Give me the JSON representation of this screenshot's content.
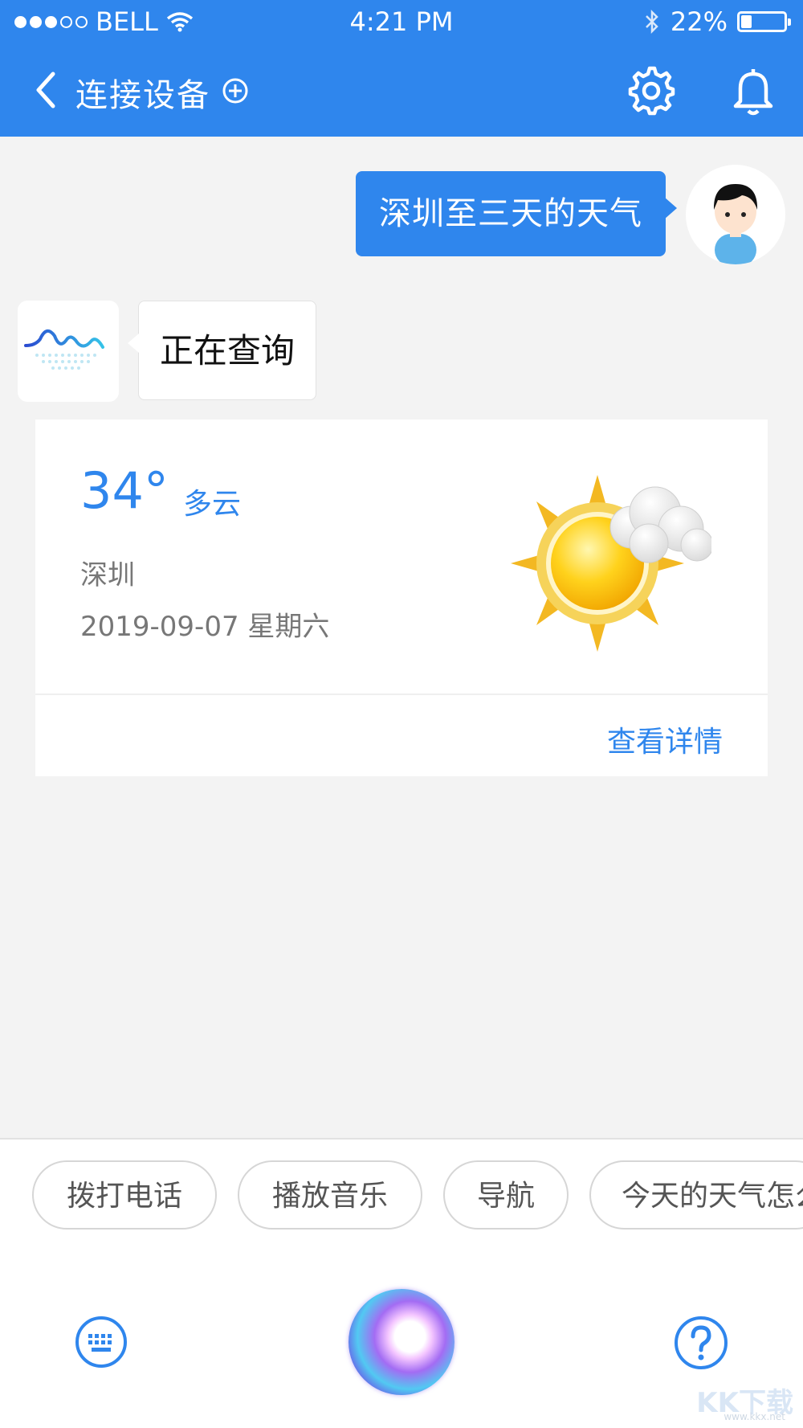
{
  "status_bar": {
    "carrier": "BELL",
    "time": "4:21 PM",
    "battery": "22%"
  },
  "nav": {
    "title": "连接设备",
    "icons": [
      "chevron-left-icon",
      "add-circle-icon",
      "gear-icon",
      "bell-icon"
    ]
  },
  "chat": {
    "user_message": "深圳至三天的天气",
    "bot_message": "正在查询"
  },
  "weather_card": {
    "temperature": "34°",
    "condition": "多云",
    "city": "深圳",
    "date": "2019-09-07 星期六",
    "detail_link": "查看详情"
  },
  "suggestions": [
    "拨打电话",
    "播放音乐",
    "导航",
    "今天的天气怎么样"
  ],
  "bottom_bar": {
    "icons": [
      "keyboard-icon",
      "voice-assistant-icon",
      "help-icon"
    ]
  },
  "watermark": {
    "logo": "KK下载",
    "url": "www.kkx.net"
  },
  "colors": {
    "primary": "#2f86ed",
    "background": "#f3f3f3",
    "sun": "#f5c21a"
  }
}
